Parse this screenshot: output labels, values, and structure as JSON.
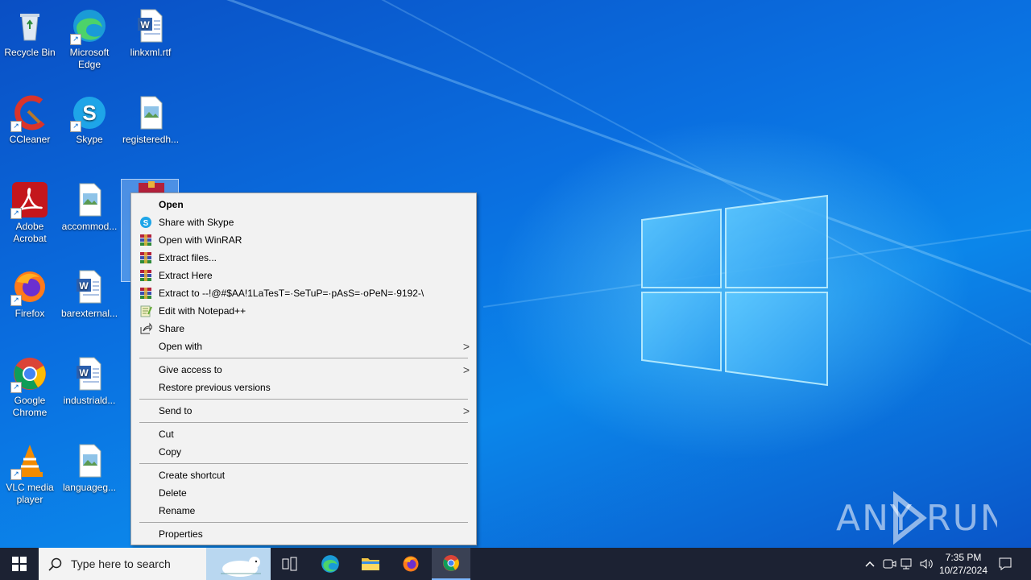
{
  "desktop": {
    "icons": [
      {
        "label": "Recycle Bin",
        "icon": "recycle-bin-icon"
      },
      {
        "label": "Microsoft Edge",
        "icon": "edge-icon"
      },
      {
        "label": "linkxml.rtf",
        "icon": "word-doc-icon"
      },
      {
        "label": "CCleaner",
        "icon": "ccleaner-icon"
      },
      {
        "label": "Skype",
        "icon": "skype-icon"
      },
      {
        "label": "registeredh...",
        "icon": "image-file-icon"
      },
      {
        "label": "Adobe Acrobat",
        "icon": "acrobat-icon"
      },
      {
        "label": "accommod...",
        "icon": "image-file-icon"
      },
      {
        "label": "Firefox",
        "icon": "firefox-icon"
      },
      {
        "label": "barexternal...",
        "icon": "word-doc-icon"
      },
      {
        "label": "Google Chrome",
        "icon": "chrome-icon"
      },
      {
        "label": "industriald...",
        "icon": "word-doc-icon"
      },
      {
        "label": "VLC media player",
        "icon": "vlc-icon"
      },
      {
        "label": "languageg...",
        "icon": "image-file-icon"
      }
    ],
    "selected_icon": {
      "icon": "winrar-archive-icon"
    }
  },
  "context_menu": {
    "items": [
      {
        "label": "Open",
        "bold": true
      },
      {
        "label": "Share with Skype",
        "icon": "skype-icon"
      },
      {
        "label": "Open with WinRAR",
        "icon": "winrar-icon"
      },
      {
        "label": "Extract files...",
        "icon": "winrar-icon"
      },
      {
        "label": "Extract Here",
        "icon": "winrar-icon"
      },
      {
        "label": "Extract to --!@#$AA!1LaTesT=·SeTuP=·pAsS=·oPeN=·9192-\\",
        "icon": "winrar-icon"
      },
      {
        "label": "Edit with Notepad++",
        "icon": "notepadpp-icon"
      },
      {
        "label": "Share",
        "icon": "share-icon"
      },
      {
        "label": "Open with",
        "submenu": true
      },
      {
        "label": "Give access to",
        "submenu": true
      },
      {
        "label": "Restore previous versions"
      },
      {
        "label": "Send to",
        "submenu": true
      },
      {
        "label": "Cut"
      },
      {
        "label": "Copy"
      },
      {
        "label": "Create shortcut"
      },
      {
        "label": "Delete"
      },
      {
        "label": "Rename"
      },
      {
        "label": "Properties"
      }
    ]
  },
  "taskbar": {
    "search_placeholder": "Type here to search",
    "pinned": [
      "task-view-icon",
      "edge-icon",
      "file-explorer-icon",
      "firefox-icon",
      "chrome-icon"
    ],
    "active": "chrome-icon",
    "clock": {
      "time": "7:35 PM",
      "date": "10/27/2024"
    }
  },
  "watermark": {
    "text": "ANY RUN"
  },
  "colors": {
    "menu_bg": "#f2f2f2",
    "taskbar_bg": "#1c2233",
    "desktop_blue": "#0a63d6"
  }
}
